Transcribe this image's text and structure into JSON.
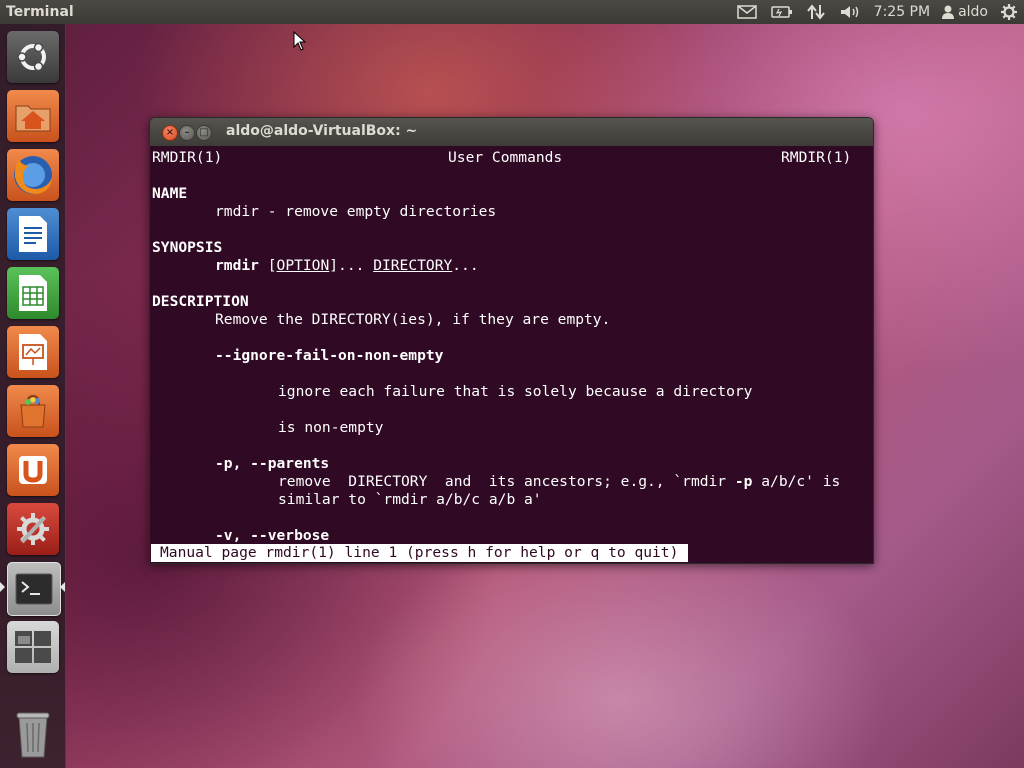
{
  "top_panel": {
    "app_title": "Terminal",
    "clock": "7:25 PM",
    "user": "aldo",
    "indicators": [
      "mail-icon",
      "battery-icon",
      "network-icon",
      "volume-icon",
      "user-icon",
      "gear-icon"
    ]
  },
  "launcher": {
    "items": [
      {
        "name": "dash-home",
        "icon": "ubuntu-logo-icon"
      },
      {
        "name": "home-folder",
        "icon": "home-folder-icon"
      },
      {
        "name": "firefox",
        "icon": "firefox-icon"
      },
      {
        "name": "libreoffice-writer",
        "icon": "writer-icon"
      },
      {
        "name": "libreoffice-calc",
        "icon": "calc-icon"
      },
      {
        "name": "libreoffice-impress",
        "icon": "impress-icon"
      },
      {
        "name": "ubuntu-software-center",
        "icon": "software-center-icon"
      },
      {
        "name": "ubuntu-one",
        "icon": "ubuntu-one-icon"
      },
      {
        "name": "system-settings",
        "icon": "settings-icon"
      },
      {
        "name": "terminal",
        "icon": "terminal-icon",
        "active": true
      },
      {
        "name": "workspace-switcher",
        "icon": "workspace-icon"
      },
      {
        "name": "trash",
        "icon": "trash-icon"
      }
    ]
  },
  "window": {
    "title": "aldo@aldo-VirtualBox: ~",
    "buttons": {
      "close": "×",
      "minimize": "–",
      "maximize": "□"
    }
  },
  "man": {
    "header_left": "RMDIR(1)",
    "header_center": "User Commands",
    "header_right": "RMDIR(1)",
    "name_heading": "NAME",
    "name_desc": "rmdir - remove empty directories",
    "synopsis_heading": "SYNOPSIS",
    "synopsis_cmd": "rmdir",
    "synopsis_option": "OPTION",
    "synopsis_mid": "]... ",
    "synopsis_open": "[",
    "synopsis_directory": "DIRECTORY",
    "synopsis_end": "...",
    "description_heading": "DESCRIPTION",
    "description_text": "Remove the DIRECTORY(ies), if they are empty.",
    "opt1_flag": "--ignore-fail-on-non-empty",
    "opt1_line1": "ignore each failure that is solely because a directory",
    "opt1_line2": "is non-empty",
    "opt2_flag": "-p, --parents",
    "opt2_line1_a": "remove  DIRECTORY  and  its ancestors; e.g., `rmdir ",
    "opt2_line1_b": "-p",
    "opt2_line1_c": " a/b/c' is",
    "opt2_line2": "similar to `rmdir a/b/c a/b a'",
    "opt3_flag": "-v, --verbose",
    "status": "Manual page rmdir(1) line 1 (press h for help or q to quit)"
  }
}
